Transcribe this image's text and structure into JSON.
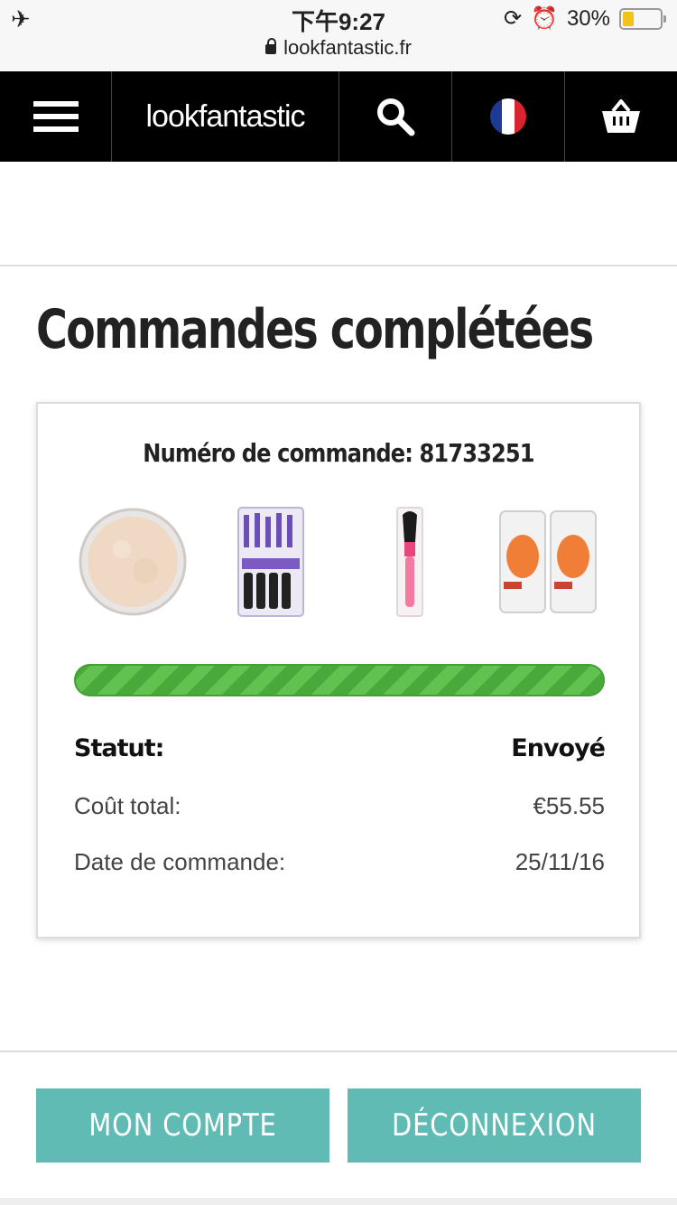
{
  "status_bar": {
    "time": "下午9:27",
    "battery": "30%",
    "battery_level": 0.3,
    "url": "lookfantastic.fr"
  },
  "nav": {
    "logo": "lookfantastic",
    "icons": [
      "menu-icon",
      "search-icon",
      "flag-france-icon",
      "basket-icon"
    ]
  },
  "page": {
    "title": "Commandes complétées"
  },
  "order": {
    "number_label": "Numéro de commande: 81733251",
    "products": [
      "loose-powder-jar",
      "brush-set",
      "blush-brush",
      "makeup-sponges"
    ],
    "progress": 1.0,
    "status_label": "Statut:",
    "status_value": "Envoyé",
    "total_label": "Coût total:",
    "total_value": "€55.55",
    "date_label": "Date de commande:",
    "date_value": "25/11/16"
  },
  "buttons": {
    "account": "MON COMPTE",
    "logout": "DÉCONNEXION"
  },
  "colors": {
    "nav_bg": "#000000",
    "button": "#5fbbb3",
    "progress": "#4aa93b"
  }
}
